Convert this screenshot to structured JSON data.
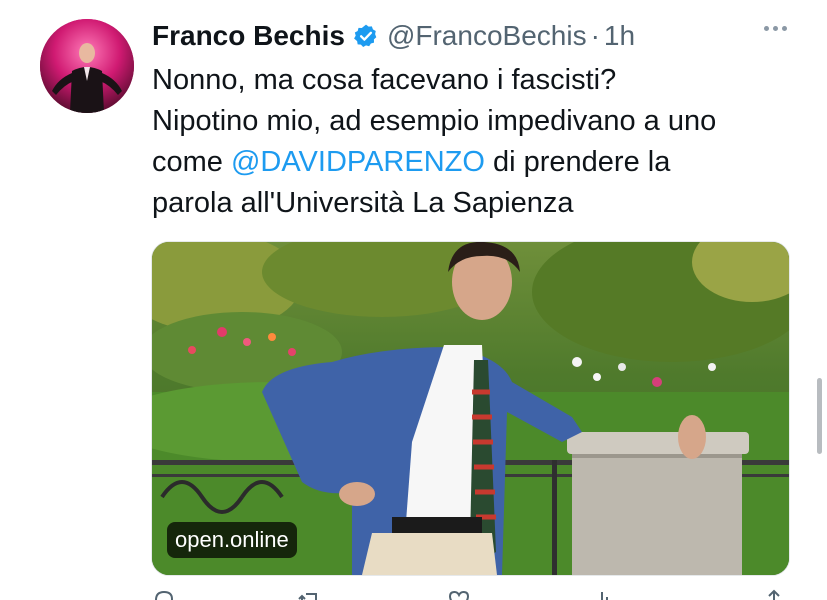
{
  "tweet": {
    "author_name": "Franco Bechis",
    "handle": "@FrancoBechis",
    "separator": "·",
    "time": "1h",
    "text_line1": "Nonno, ma cosa facevano i fascisti?",
    "text_line2": "Nipotino mio, ad esempio impedivano a uno",
    "text_prefix": "come ",
    "mention": "@DAVIDPARENZO",
    "text_suffix": " di prendere la",
    "text_line4": "parola all'Università La Sapienza",
    "link_domain": "open.online"
  },
  "icons": {
    "verified": "verified-badge-icon",
    "more": "more-options-icon",
    "actions": [
      "reply-icon",
      "retweet-icon",
      "like-icon",
      "views-icon",
      "share-icon"
    ]
  },
  "colors": {
    "accent": "#1d9bf0",
    "text_primary": "#0f1419",
    "text_secondary": "#536471"
  }
}
